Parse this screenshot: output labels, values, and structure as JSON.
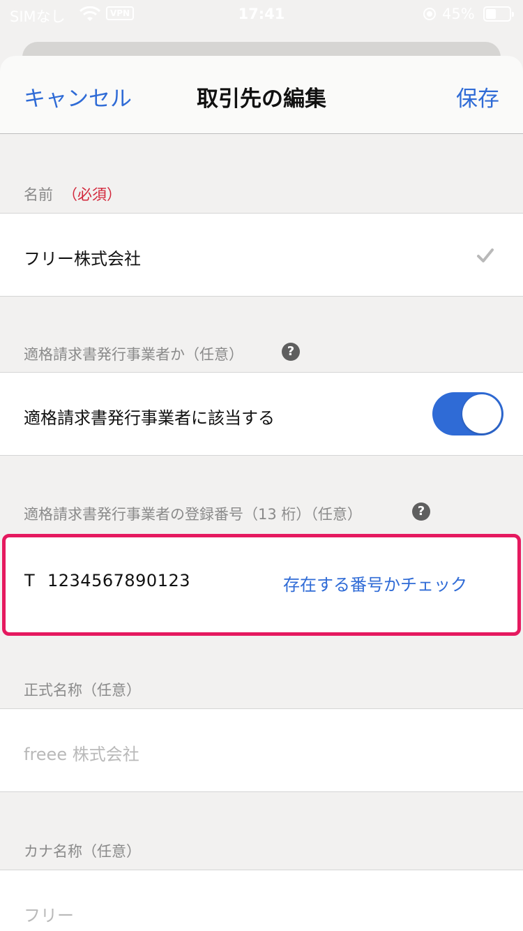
{
  "status_bar": {
    "carrier": "SIMなし",
    "vpn": "VPN",
    "time": "17:41",
    "battery": "45%"
  },
  "nav": {
    "cancel": "キャンセル",
    "title": "取引先の編集",
    "save": "保存"
  },
  "name_section": {
    "label": "名前",
    "required": "（必須）",
    "value": "フリー株式会社"
  },
  "invoice_issuer_section": {
    "label": "適格請求書発行事業者か（任意）",
    "toggle_label": "適格請求書発行事業者に該当する",
    "toggle_on": true
  },
  "registration_section": {
    "label": "適格請求書発行事業者の登録番号（13 桁）（任意）",
    "prefix": "T",
    "number": "1234567890123",
    "check_link": "存在する番号かチェック"
  },
  "official_name_section": {
    "label": "正式名称（任意）",
    "placeholder": "freee 株式会社"
  },
  "kana_section": {
    "label": "カナ名称（任意）",
    "placeholder": "フリー"
  },
  "colors": {
    "accent": "#2f6bd6",
    "required": "#d2263a",
    "highlight": "#e5195f",
    "background": "#f2f1f0"
  }
}
